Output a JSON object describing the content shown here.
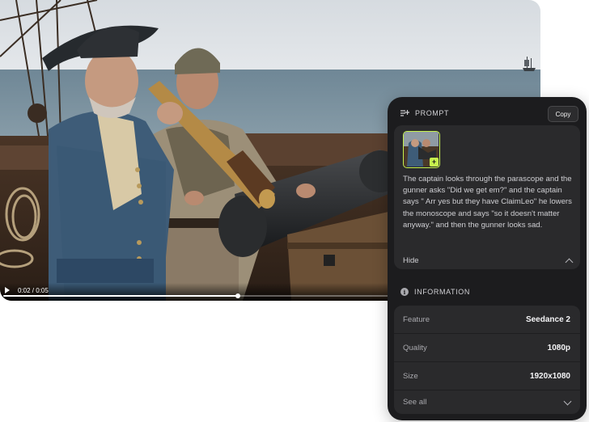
{
  "player": {
    "timecode": "0:02 / 0:05",
    "progress": 0.44
  },
  "prompt_section": {
    "title": "PROMPT",
    "copy_label": "Copy",
    "text": "The captain looks through the parascope and the gunner asks \"Did we get em?\" and the captain says \" Arr yes but they have ClaimLeo\" he lowers the monoscope and says \"so it doesn't matter anyway.\" and then the gunner looks sad.",
    "hide_label": "Hide"
  },
  "information_section": {
    "title": "INFORMATION",
    "rows": [
      {
        "label": "Feature",
        "value": "Seedance 2"
      },
      {
        "label": "Quality",
        "value": "1080p"
      },
      {
        "label": "Size",
        "value": "1920x1080"
      }
    ],
    "see_all_label": "See all"
  },
  "colors": {
    "panel_bg": "#1c1c1e",
    "card_bg": "#2a2a2c",
    "accent": "#c6f24e"
  }
}
